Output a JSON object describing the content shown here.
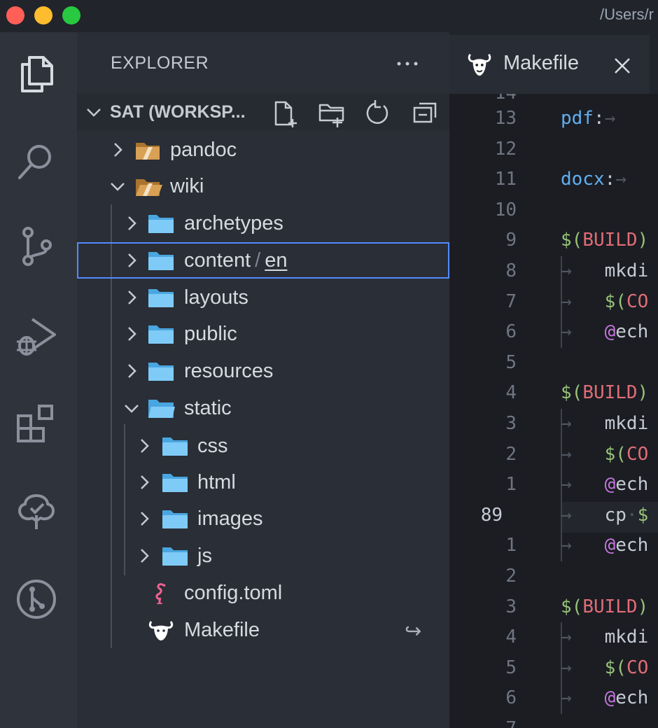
{
  "window": {
    "path": "/Users/r",
    "colors": {
      "close": "#ff5f57",
      "minimize": "#febc2e",
      "zoom": "#28c840"
    }
  },
  "activity_bar": {
    "items": [
      "explorer-icon",
      "search-icon",
      "source-control-icon",
      "run-debug-icon",
      "extensions-icon",
      "tree-icon",
      "git-graph-icon"
    ]
  },
  "sidebar": {
    "title": "EXPLORER",
    "more_actions": "more-icon",
    "section": {
      "title": "SAT (WORKSP...",
      "actions": [
        "new-file-icon",
        "new-folder-icon",
        "refresh-icon",
        "collapse-all-icon"
      ]
    },
    "tree": [
      {
        "label": "pandoc",
        "type": "root-folder",
        "expanded": false
      },
      {
        "label": "wiki",
        "type": "root-folder",
        "expanded": true
      },
      {
        "label": "archetypes",
        "type": "folder",
        "expanded": false
      },
      {
        "label": "content",
        "compact_child": "en",
        "separator": "/",
        "type": "folder",
        "expanded": false,
        "selected": true
      },
      {
        "label": "layouts",
        "type": "folder",
        "expanded": false
      },
      {
        "label": "public",
        "type": "folder",
        "expanded": false
      },
      {
        "label": "resources",
        "type": "folder",
        "expanded": false
      },
      {
        "label": "static",
        "type": "folder",
        "expanded": true
      },
      {
        "label": "css",
        "type": "folder",
        "expanded": false
      },
      {
        "label": "html",
        "type": "folder",
        "expanded": false
      },
      {
        "label": "images",
        "type": "folder",
        "expanded": false
      },
      {
        "label": "js",
        "type": "folder",
        "expanded": false
      },
      {
        "label": "config.toml",
        "type": "file",
        "icon": "flamingo-icon"
      },
      {
        "label": "Makefile",
        "type": "file",
        "icon": "gnu-icon",
        "badge": "↪"
      }
    ]
  },
  "tabs": [
    {
      "label": "Makefile",
      "icon": "gnu-icon",
      "close": "✕",
      "active": true
    }
  ],
  "editor": {
    "current_line": "89",
    "line_numbers": [
      "13",
      "12",
      "11",
      "10",
      "9",
      "8",
      "7",
      "6",
      "5",
      "4",
      "3",
      "2",
      "1",
      "89",
      "1",
      "2",
      "3",
      "4",
      "5",
      "6",
      "7"
    ],
    "lines": [
      {
        "tokens": [
          {
            "t": "pdf",
            "c": "blue"
          },
          {
            "t": ":",
            "c": "plain"
          },
          {
            "t": "→",
            "c": "ws"
          }
        ]
      },
      {
        "tokens": []
      },
      {
        "tokens": [
          {
            "t": "docx",
            "c": "blue"
          },
          {
            "t": ":",
            "c": "plain"
          },
          {
            "t": "→",
            "c": "ws"
          }
        ]
      },
      {
        "tokens": []
      },
      {
        "tokens": [
          {
            "t": "$(",
            "c": "green"
          },
          {
            "t": "BUILD",
            "c": "red"
          },
          {
            "t": ")",
            "c": "green"
          }
        ]
      },
      {
        "tokens": [
          {
            "t": "→   ",
            "c": "ws"
          },
          {
            "t": "mkdi",
            "c": "plain"
          }
        ]
      },
      {
        "tokens": [
          {
            "t": "→   ",
            "c": "ws"
          },
          {
            "t": "$(",
            "c": "green"
          },
          {
            "t": "CO",
            "c": "red"
          }
        ]
      },
      {
        "tokens": [
          {
            "t": "→   ",
            "c": "ws"
          },
          {
            "t": "@",
            "c": "purple"
          },
          {
            "t": "ech",
            "c": "plain"
          }
        ]
      },
      {
        "tokens": []
      },
      {
        "tokens": [
          {
            "t": "$(",
            "c": "green"
          },
          {
            "t": "BUILD",
            "c": "red"
          },
          {
            "t": ")",
            "c": "green"
          }
        ]
      },
      {
        "tokens": [
          {
            "t": "→   ",
            "c": "ws"
          },
          {
            "t": "mkdi",
            "c": "plain"
          }
        ]
      },
      {
        "tokens": [
          {
            "t": "→   ",
            "c": "ws"
          },
          {
            "t": "$(",
            "c": "green"
          },
          {
            "t": "CO",
            "c": "red"
          }
        ]
      },
      {
        "tokens": [
          {
            "t": "→   ",
            "c": "ws"
          },
          {
            "t": "@",
            "c": "purple"
          },
          {
            "t": "ech",
            "c": "plain"
          }
        ]
      },
      {
        "tokens": [
          {
            "t": "→   ",
            "c": "ws"
          },
          {
            "t": "cp",
            "c": "plain"
          },
          {
            "t": "·",
            "c": "ws"
          },
          {
            "t": "$",
            "c": "green"
          }
        ]
      },
      {
        "tokens": [
          {
            "t": "→   ",
            "c": "ws"
          },
          {
            "t": "@",
            "c": "purple"
          },
          {
            "t": "ech",
            "c": "plain"
          }
        ]
      },
      {
        "tokens": []
      },
      {
        "tokens": [
          {
            "t": "$(",
            "c": "green"
          },
          {
            "t": "BUILD",
            "c": "red"
          },
          {
            "t": ")",
            "c": "green"
          }
        ]
      },
      {
        "tokens": [
          {
            "t": "→   ",
            "c": "ws"
          },
          {
            "t": "mkdi",
            "c": "plain"
          }
        ]
      },
      {
        "tokens": [
          {
            "t": "→   ",
            "c": "ws"
          },
          {
            "t": "$(",
            "c": "green"
          },
          {
            "t": "CO",
            "c": "red"
          }
        ]
      },
      {
        "tokens": [
          {
            "t": "→   ",
            "c": "ws"
          },
          {
            "t": "@",
            "c": "purple"
          },
          {
            "t": "ech",
            "c": "plain"
          }
        ]
      },
      {
        "tokens": []
      }
    ]
  }
}
